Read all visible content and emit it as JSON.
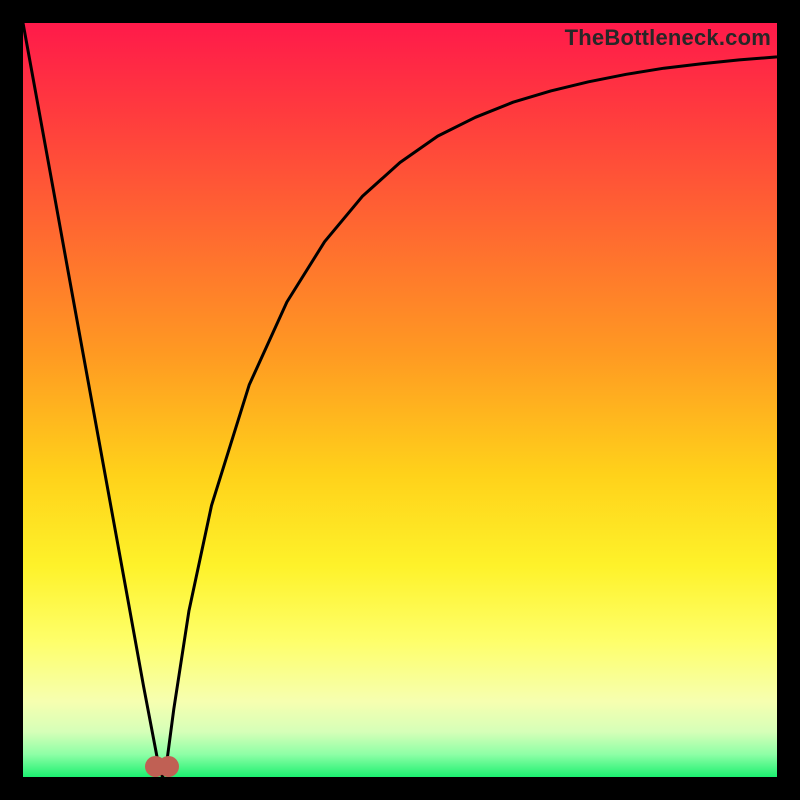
{
  "attribution": "TheBottleneck.com",
  "chart_data": {
    "type": "line",
    "title": "",
    "xlabel": "",
    "ylabel": "",
    "x": [
      0.0,
      0.02,
      0.04,
      0.06,
      0.08,
      0.1,
      0.12,
      0.14,
      0.16,
      0.18,
      0.185,
      0.19,
      0.2,
      0.22,
      0.25,
      0.3,
      0.35,
      0.4,
      0.45,
      0.5,
      0.55,
      0.6,
      0.65,
      0.7,
      0.75,
      0.8,
      0.85,
      0.9,
      0.95,
      1.0
    ],
    "values": [
      1.0,
      0.89,
      0.78,
      0.67,
      0.56,
      0.45,
      0.34,
      0.23,
      0.12,
      0.015,
      0.0,
      0.015,
      0.09,
      0.22,
      0.36,
      0.52,
      0.63,
      0.71,
      0.77,
      0.815,
      0.85,
      0.875,
      0.895,
      0.91,
      0.922,
      0.932,
      0.94,
      0.946,
      0.951,
      0.955
    ],
    "xlim": [
      0,
      1
    ],
    "ylim": [
      0,
      1
    ],
    "dip_x": 0.185,
    "background_gradient": {
      "top": "#ff1a4a",
      "mid": "#fef22a",
      "bottom": "#1cf070"
    },
    "marker": {
      "x": 0.185,
      "y": 0.0,
      "color": "#c06054"
    }
  }
}
